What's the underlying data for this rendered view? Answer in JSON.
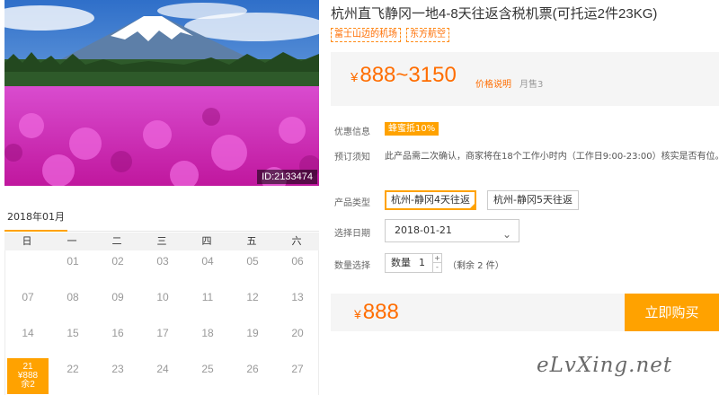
{
  "photo": {
    "id_label": "ID:2133474",
    "alt": "Mount Fuji and pink moss phlox field"
  },
  "product": {
    "title": "杭州直飞静冈一地4-8天往返含税机票(可托运2件23KG)",
    "tags": [
      "富士山边的机场",
      "东方航空"
    ],
    "price_currency": "¥",
    "price_range": "888~3150",
    "price_note": "价格说明",
    "monthly_sales": "月售3"
  },
  "promo": {
    "label": "优惠信息",
    "badge": "蜂蜜抵10%"
  },
  "booking_notice": {
    "label": "预订须知",
    "text": "此产品需二次确认，商家将在18个工作小时内（工作日9:00-23:00）核实是否有位。"
  },
  "product_type": {
    "label": "产品类型",
    "options": [
      "杭州-静冈4天往返",
      "杭州-静冈5天往返"
    ],
    "selected_index": 0
  },
  "date_select": {
    "label": "选择日期",
    "value": "2018-01-21"
  },
  "quantity": {
    "label": "数量选择",
    "prefix": "数量",
    "value": "1",
    "plus": "+",
    "minus": "-",
    "remaining": "（剩余 2 件）"
  },
  "buy": {
    "currency": "¥",
    "price": "888",
    "button": "立即购买"
  },
  "calendar": {
    "month": "2018年01月",
    "weekdays": [
      "日",
      "一",
      "二",
      "三",
      "四",
      "五",
      "六"
    ],
    "weeks": [
      [
        "",
        "01",
        "02",
        "03",
        "04",
        "05",
        "06"
      ],
      [
        "07",
        "08",
        "09",
        "10",
        "11",
        "12",
        "13"
      ],
      [
        "14",
        "15",
        "16",
        "17",
        "18",
        "19",
        "20"
      ],
      [
        "21",
        "22",
        "23",
        "24",
        "25",
        "26",
        "27"
      ]
    ],
    "selected": {
      "day": "21",
      "price": "¥888",
      "remain": "余2"
    }
  },
  "watermark": "eLvXing.net",
  "colors": {
    "accent": "#ffa200",
    "price": "#ff6d00"
  }
}
